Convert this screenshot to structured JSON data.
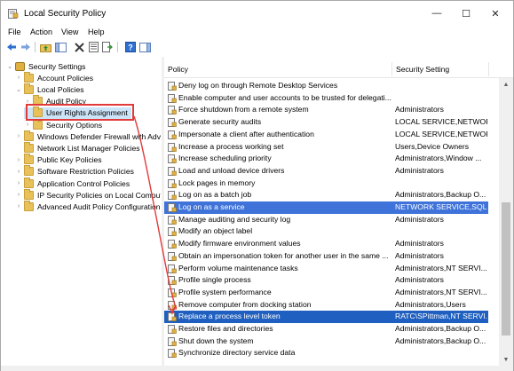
{
  "window": {
    "title": "Local Security Policy"
  },
  "controls": {
    "minimize": "—",
    "maximize": "☐",
    "close": "✕"
  },
  "menu": [
    "File",
    "Action",
    "View",
    "Help"
  ],
  "tree": [
    {
      "label": "Security Settings",
      "level": 0,
      "expander": "⌄"
    },
    {
      "label": "Account Policies",
      "level": 1,
      "expander": "›"
    },
    {
      "label": "Local Policies",
      "level": 1,
      "expander": "⌄"
    },
    {
      "label": "Audit Policy",
      "level": 2,
      "expander": "›"
    },
    {
      "label": "User Rights Assignment",
      "level": 2,
      "expander": ""
    },
    {
      "label": "Security Options",
      "level": 2,
      "expander": "›"
    },
    {
      "label": "Windows Defender Firewall with Advar",
      "level": 1,
      "expander": "›"
    },
    {
      "label": "Network List Manager Policies",
      "level": 1,
      "expander": ""
    },
    {
      "label": "Public Key Policies",
      "level": 1,
      "expander": "›"
    },
    {
      "label": "Software Restriction Policies",
      "level": 1,
      "expander": "›"
    },
    {
      "label": "Application Control Policies",
      "level": 1,
      "expander": "›"
    },
    {
      "label": "IP Security Policies on Local Computer",
      "level": 1,
      "expander": "›"
    },
    {
      "label": "Advanced Audit Policy Configuration",
      "level": 1,
      "expander": "›"
    }
  ],
  "list": {
    "columns": {
      "policy": "Policy",
      "setting": "Security Setting"
    },
    "rows": [
      {
        "policy": "Deny log on through Remote Desktop Services",
        "setting": ""
      },
      {
        "policy": "Enable computer and user accounts to be trusted for delegati...",
        "setting": ""
      },
      {
        "policy": "Force shutdown from a remote system",
        "setting": "Administrators"
      },
      {
        "policy": "Generate security audits",
        "setting": "LOCAL SERVICE,NETWOR..."
      },
      {
        "policy": "Impersonate a client after authentication",
        "setting": "LOCAL SERVICE,NETWOR..."
      },
      {
        "policy": "Increase a process working set",
        "setting": "Users,Device Owners"
      },
      {
        "policy": "Increase scheduling priority",
        "setting": "Administrators,Window ..."
      },
      {
        "policy": "Load and unload device drivers",
        "setting": "Administrators"
      },
      {
        "policy": "Lock pages in memory",
        "setting": ""
      },
      {
        "policy": "Log on as a batch job",
        "setting": "Administrators,Backup O..."
      },
      {
        "policy": "Log on as a service",
        "setting": "NETWORK SERVICE,SQLS..."
      },
      {
        "policy": "Manage auditing and security log",
        "setting": "Administrators"
      },
      {
        "policy": "Modify an object label",
        "setting": ""
      },
      {
        "policy": "Modify firmware environment values",
        "setting": "Administrators"
      },
      {
        "policy": "Obtain an impersonation token for another user in the same ...",
        "setting": "Administrators"
      },
      {
        "policy": "Perform volume maintenance tasks",
        "setting": "Administrators,NT SERVI..."
      },
      {
        "policy": "Profile single process",
        "setting": "Administrators"
      },
      {
        "policy": "Profile system performance",
        "setting": "Administrators,NT SERVI..."
      },
      {
        "policy": "Remove computer from docking station",
        "setting": "Administrators,Users"
      },
      {
        "policy": "Replace a process level token",
        "setting": "RATC\\SPittman,NT SERVI..."
      },
      {
        "policy": "Restore files and directories",
        "setting": "Administrators,Backup O..."
      },
      {
        "policy": "Shut down the system",
        "setting": "Administrators,Backup O..."
      },
      {
        "policy": "Synchronize directory service data",
        "setting": ""
      }
    ]
  },
  "colors": {
    "selected_row": "#3f73d9",
    "selected_row_dark": "#1f5fbf",
    "highlight": "#e23a3a"
  }
}
